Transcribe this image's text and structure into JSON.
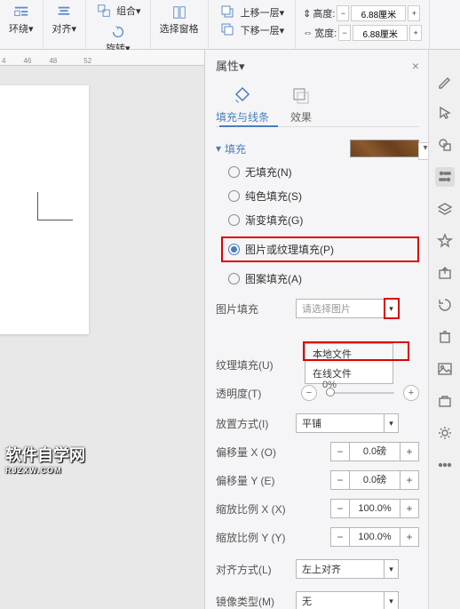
{
  "ribbon": {
    "wrap": "环绕▾",
    "align": "对齐▾",
    "group_label": "组合▾",
    "rotate": "旋转▾",
    "select_pane": "选择窗格",
    "up_layer": "上移一层▾",
    "down_layer": "下移一层▾",
    "height_label": "高度:",
    "height_value": "6.88厘米",
    "width_label": "宽度:",
    "width_value": "6.88厘米"
  },
  "ruler": {
    "ticks": [
      "4",
      "46",
      "48",
      "52"
    ]
  },
  "panel": {
    "title": "属性▾",
    "tabs": {
      "fill": "填充与线条",
      "effects": "效果"
    },
    "section_fill": "填充",
    "radios": {
      "none": "无填充(N)",
      "solid": "纯色填充(S)",
      "gradient": "渐变填充(G)",
      "picture": "图片或纹理填充(P)",
      "pattern": "图案填充(A)"
    },
    "fields": {
      "pic_fill_label": "图片填充",
      "pic_fill_placeholder": "请选择图片",
      "dropdown": {
        "local": "本地文件",
        "online": "在线文件"
      },
      "texture_label": "纹理填充(U)",
      "opacity_label": "透明度(T)",
      "opacity_value": "0%",
      "tile_label": "放置方式(I)",
      "tile_value": "平铺",
      "offset_x_label": "偏移量 X (O)",
      "offset_x_value": "0.0磅",
      "offset_y_label": "偏移量 Y (E)",
      "offset_y_value": "0.0磅",
      "scale_x_label": "缩放比例 X (X)",
      "scale_x_value": "100.0%",
      "scale_y_label": "缩放比例 Y (Y)",
      "scale_y_value": "100.0%",
      "align_label": "对齐方式(L)",
      "align_value": "左上对齐",
      "mirror_label": "镜像类型(M)",
      "mirror_value": "无"
    }
  },
  "watermark": {
    "main": "软件自学网",
    "sub": "RJZXW.COM"
  }
}
